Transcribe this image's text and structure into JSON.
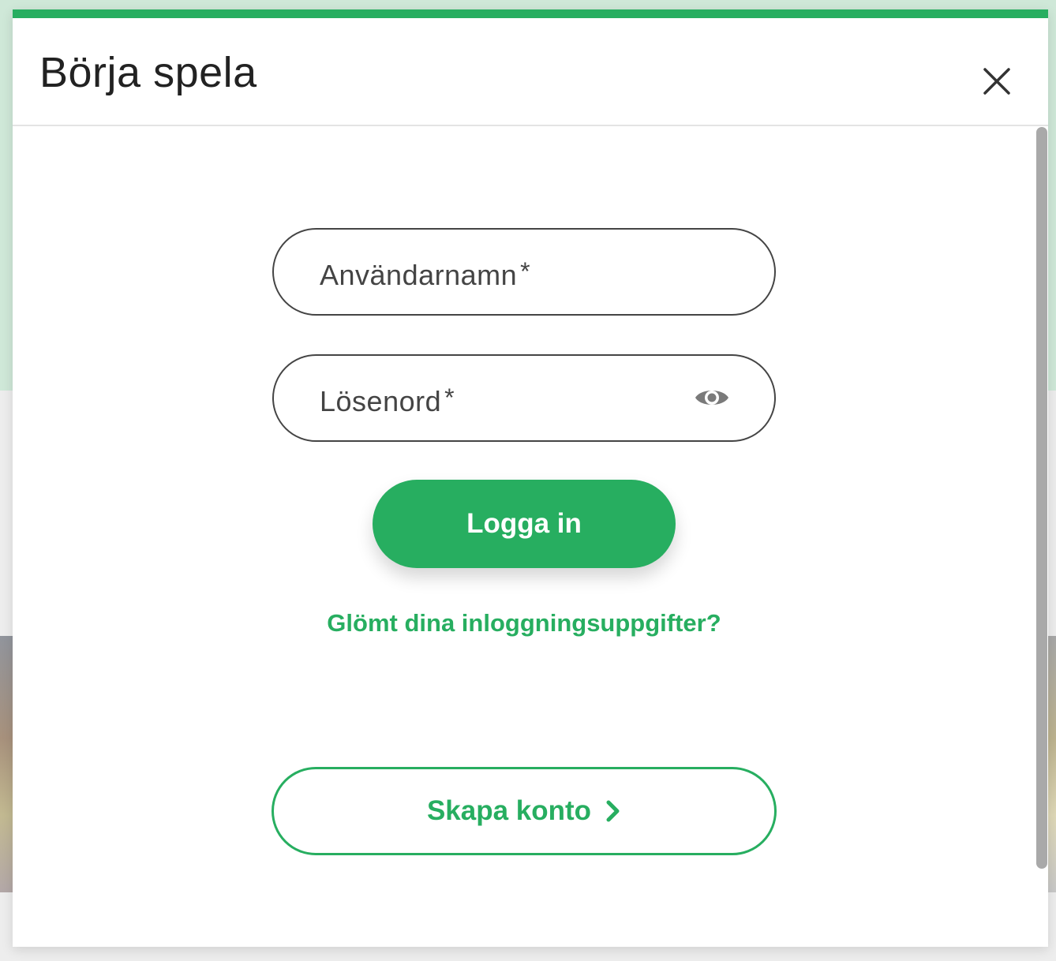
{
  "modal": {
    "title": "Börja spela",
    "close_icon": "close-icon",
    "accent_color": "#27ae60"
  },
  "form": {
    "username": {
      "label": "Användarnamn",
      "required_mark": "*"
    },
    "password": {
      "label": "Lösenord",
      "required_mark": "*",
      "toggle_icon": "eye-icon"
    },
    "login_button_label": "Logga in",
    "forgot_link_label": "Glömt dina inloggningsuppgifter?",
    "create_account_label": "Skapa konto",
    "create_account_icon": "chevron-right-icon"
  }
}
